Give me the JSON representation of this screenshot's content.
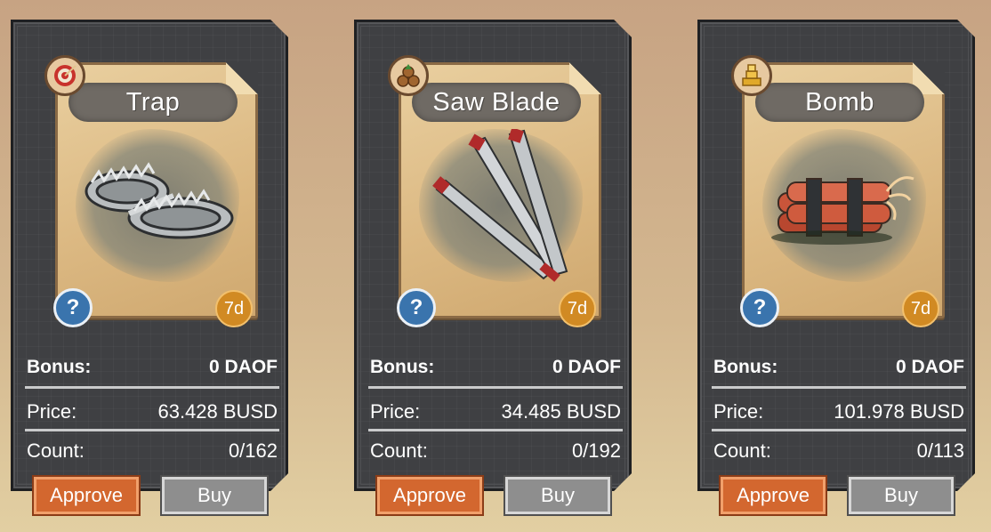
{
  "labels": {
    "bonus": "Bonus:",
    "price": "Price:",
    "count": "Count:",
    "approve": "Approve",
    "buy": "Buy",
    "help": "?"
  },
  "cards": [
    {
      "title": "Trap",
      "icon": "trap-icon",
      "category_icon": "target-icon",
      "duration": "7d",
      "bonus": "0 DAOF",
      "price": "63.428 BUSD",
      "count": "0/162"
    },
    {
      "title": "Saw Blade",
      "icon": "saw-blade-icon",
      "category_icon": "logs-icon",
      "duration": "7d",
      "bonus": "0 DAOF",
      "price": "34.485 BUSD",
      "count": "0/192"
    },
    {
      "title": "Bomb",
      "icon": "dynamite-icon",
      "category_icon": "gold-bars-icon",
      "duration": "7d",
      "bonus": "0 DAOF",
      "price": "101.978 BUSD",
      "count": "0/113"
    }
  ],
  "colors": {
    "approve": "#d3672f",
    "buy": "#8e8e8e",
    "help_badge": "#3a74ad",
    "duration_badge": "#d18a23",
    "card_bg": "#3f4043"
  }
}
